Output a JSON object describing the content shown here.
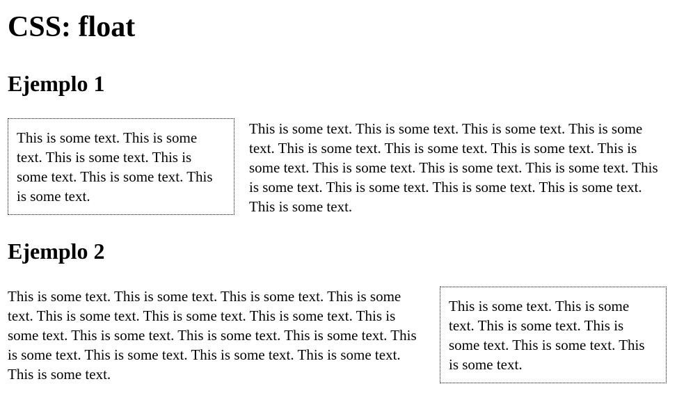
{
  "page": {
    "title": "CSS: float"
  },
  "examples": [
    {
      "heading": "Ejemplo 1",
      "float_side": "left",
      "box_text": "This is some text. This is some text. This is some text. This is some text. This is some text. This is some text.",
      "paragraph_text": "This is some text. This is some text. This is some text. This is some text. This is some text. This is some text. This is some text. This is some text. This is some text. This is some text. This is some text. This is some text. This is some text. This is some text. This is some text. This is some text."
    },
    {
      "heading": "Ejemplo 2",
      "float_side": "right",
      "box_text": "This is some text. This is some text. This is some text. This is some text. This is some text. This is some text.",
      "paragraph_text": "This is some text. This is some text. This is some text. This is some text. This is some text. This is some text. This is some text. This is some text. This is some text. This is some text. This is some text. This is some text. This is some text. This is some text. This is some text. This is some text."
    }
  ]
}
